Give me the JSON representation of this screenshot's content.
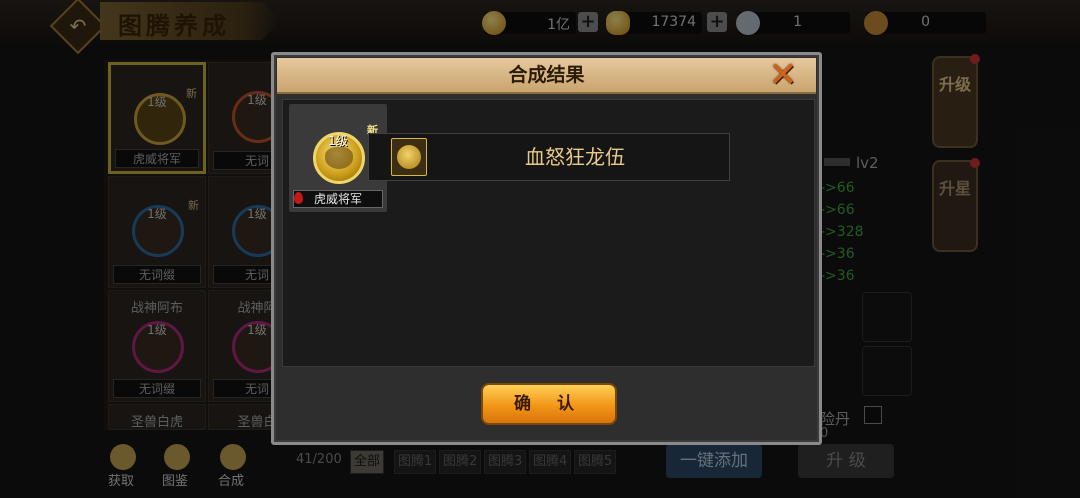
{
  "header": {
    "title": "图腾养成",
    "resources": [
      {
        "icon": "gold-coin-icon",
        "value": "1亿"
      },
      {
        "icon": "gold-ingot-icon",
        "value": "17374"
      },
      {
        "icon": "silver-item-icon",
        "value": "1"
      },
      {
        "icon": "bronze-item-icon",
        "value": "0"
      }
    ]
  },
  "grid": {
    "cells": [
      {
        "level": "1级",
        "name": "虎威将军",
        "new": "新",
        "header": ""
      },
      {
        "level": "1级",
        "name": "无词",
        "new": "",
        "header": ""
      },
      {
        "level": "1级",
        "name": "无词缀",
        "new": "新",
        "header": ""
      },
      {
        "level": "1级",
        "name": "无词",
        "new": "",
        "header": ""
      },
      {
        "level": "1级",
        "name": "无词缀",
        "new": "",
        "header": "战神阿布"
      },
      {
        "level": "1级",
        "name": "无词",
        "new": "",
        "header": "战神阿"
      }
    ],
    "row4_headers": [
      "圣兽白虎",
      "圣兽白"
    ]
  },
  "bottom": {
    "buttons": [
      "获取",
      "图鉴",
      "合成"
    ],
    "page_count": "41/200",
    "filter_tabs": [
      "全部",
      "图腾1",
      "图腾2",
      "图腾3",
      "图腾4",
      "图腾5"
    ],
    "add_all": "一键添加",
    "upgrade": "升 级"
  },
  "right": {
    "tab_upgrade": "升级",
    "tab_star": "升星",
    "level_label": "lv2",
    "stats": [
      "->66",
      "->66",
      "->328",
      "->36",
      "->36"
    ],
    "item_label": "险丹",
    "item_count": "0"
  },
  "dialog": {
    "title": "合成结果",
    "result": {
      "level": "1级",
      "new_badge": "新",
      "name": "虎威将军"
    },
    "gem_name": "血怒狂龙伍",
    "confirm": "确 认"
  },
  "colors": {
    "accent": "#f29618",
    "stat_green": "#3ea63e",
    "title_gold": "#e9c98a"
  }
}
